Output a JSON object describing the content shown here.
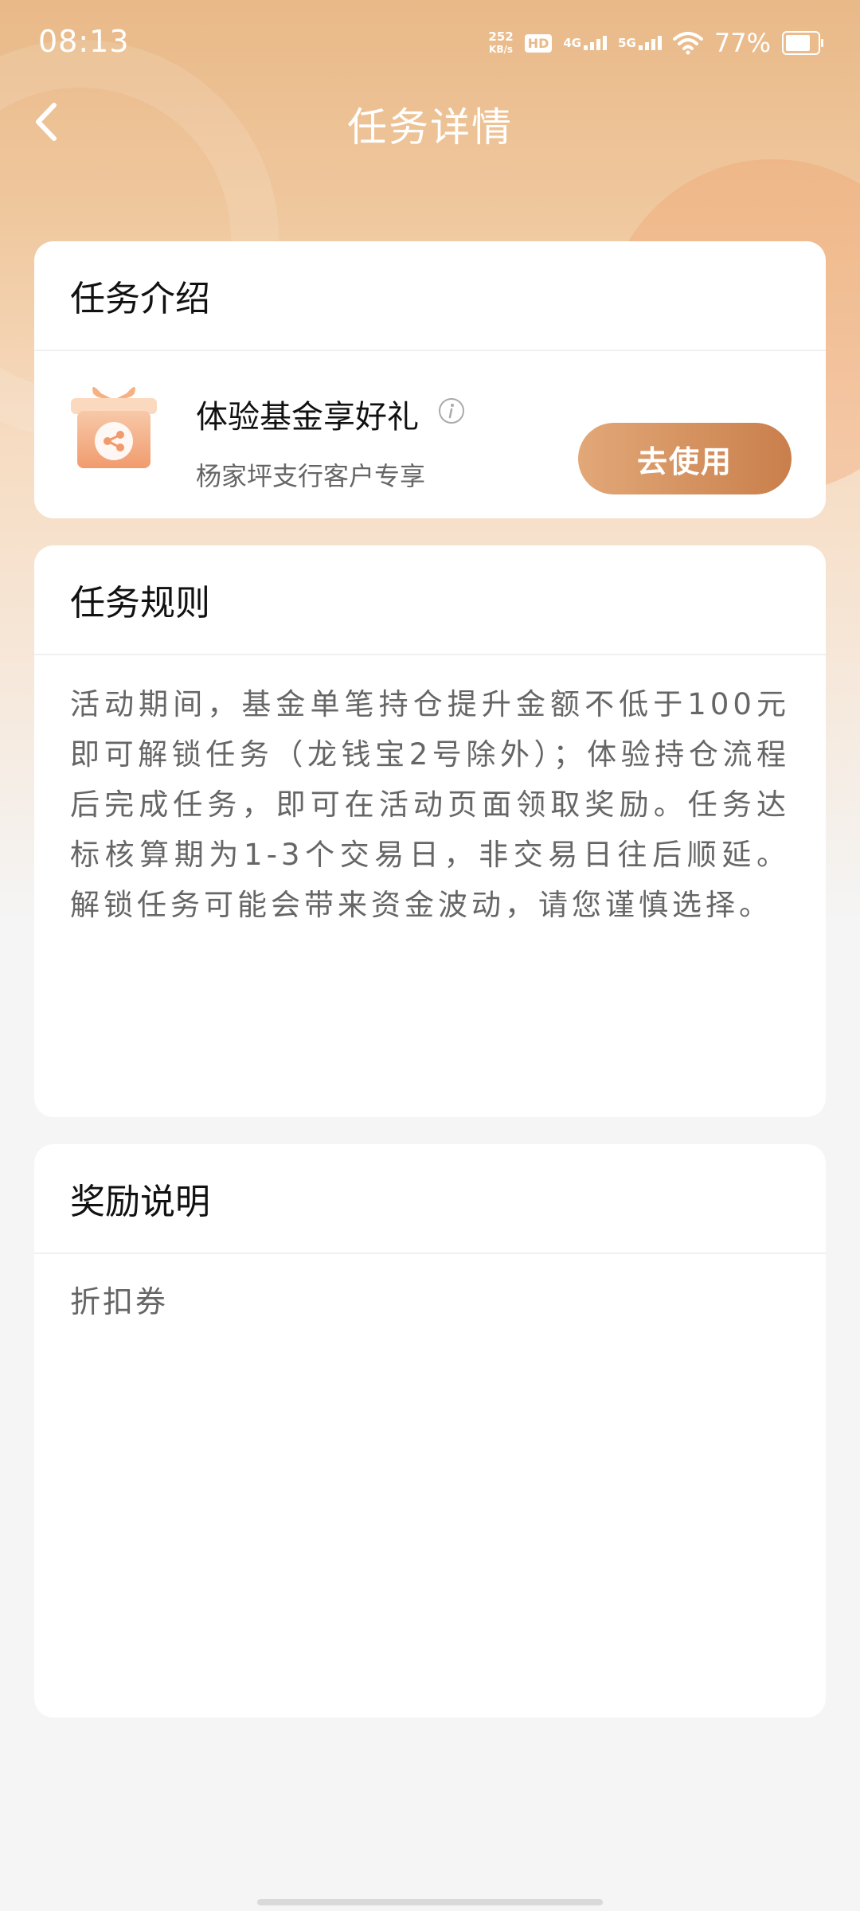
{
  "status_bar": {
    "time": "08:13",
    "net_speed_value": "252",
    "net_speed_unit": "KB/s",
    "hd_label": "HD",
    "signal_1_label": "4G",
    "signal_2_label": "5G",
    "battery_percent": "77%"
  },
  "nav": {
    "title": "任务详情"
  },
  "intro": {
    "header": "任务介绍",
    "task_name": "体验基金享好礼",
    "task_sub": "杨家坪支行客户专享",
    "button_label": "去使用"
  },
  "rules": {
    "header": "任务规则",
    "text": "活动期间，基金单笔持仓提升金额不低于100元即可解锁任务（龙钱宝2号除外）；体验持仓流程后完成任务，即可在活动页面领取奖励。任务达标核算期为1-3个交易日，非交易日往后顺延。解锁任务可能会带来资金波动，请您谨慎选择。"
  },
  "reward": {
    "header": "奖励说明",
    "text": "折扣券"
  },
  "colors": {
    "accent_start": "#e2a878",
    "accent_end": "#c97f4b",
    "hero_top": "#e9b988"
  }
}
